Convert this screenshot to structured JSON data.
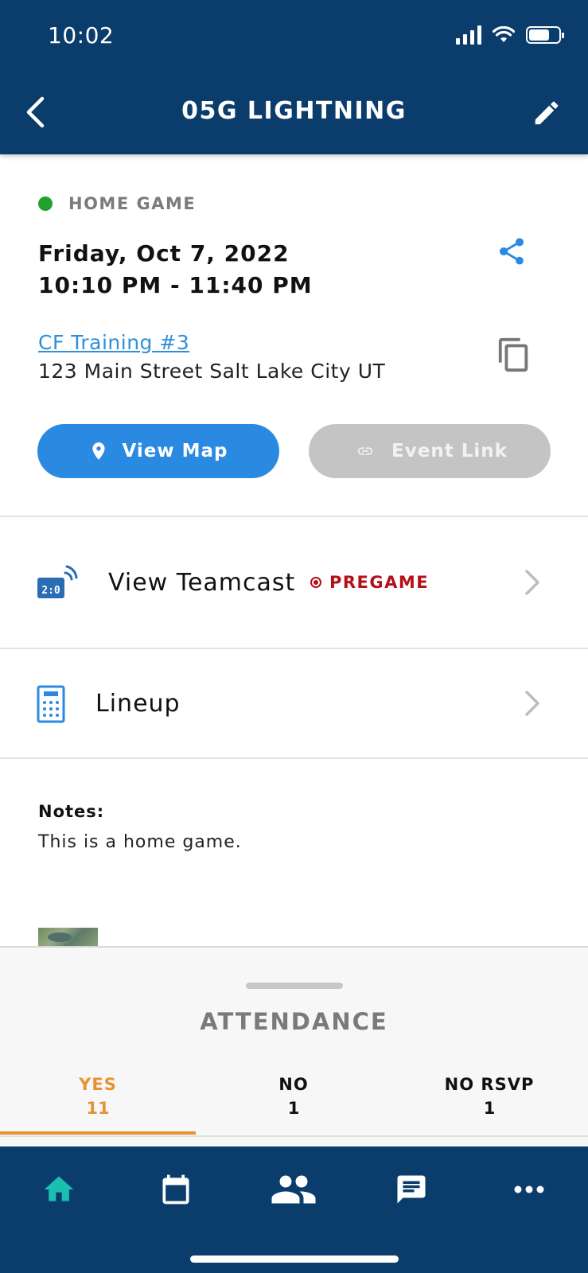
{
  "status_bar": {
    "time": "10:02"
  },
  "header": {
    "title": "05G LIGHTNING"
  },
  "event": {
    "type_label": "HOME GAME",
    "type_color": "#23a12d",
    "date": "Friday, Oct 7, 2022",
    "time_range": "10:10 PM - 11:40 PM",
    "location_name": "CF Training #3",
    "address": "123 Main Street Salt Lake City UT",
    "buttons": {
      "map": "View Map",
      "link": "Event Link"
    }
  },
  "rows": {
    "teamcast": {
      "label": "View Teamcast",
      "badge": "PREGAME",
      "icon_text": "2:0"
    },
    "lineup": {
      "label": "Lineup"
    }
  },
  "notes": {
    "label": "Notes:",
    "text": "This is a home game."
  },
  "attendance": {
    "title": "ATTENDANCE",
    "tabs": [
      {
        "key": "YES",
        "count": "11"
      },
      {
        "key": "NO",
        "count": "1"
      },
      {
        "key": "NO RSVP",
        "count": "1"
      }
    ]
  },
  "bottom_nav": [
    "home-icon",
    "calendar-icon",
    "team-icon",
    "messages-icon",
    "more-icon"
  ],
  "colors": {
    "primary": "#0a3d6b",
    "accent_blue": "#2a8ae2",
    "accent_orange": "#e49433",
    "live_red": "#b3101a",
    "nav_active": "#1bbfb0"
  }
}
